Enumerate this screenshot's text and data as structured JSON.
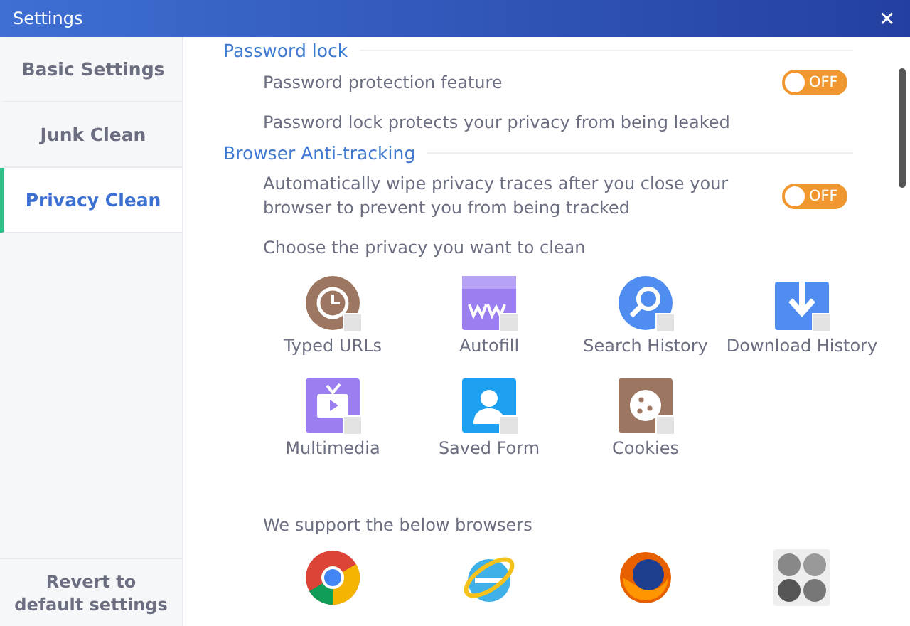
{
  "window": {
    "title": "Settings",
    "close": "✕"
  },
  "sidebar": {
    "items": [
      {
        "label": "Basic Settings",
        "selected": false
      },
      {
        "label": "Junk Clean",
        "selected": false
      },
      {
        "label": "Privacy Clean",
        "selected": true
      }
    ],
    "footer": "Revert to default settings"
  },
  "sections": [
    {
      "title": "Password lock",
      "rows": [
        {
          "text": "Password protection feature",
          "toggle": {
            "on": false,
            "label": "OFF"
          }
        },
        {
          "text": "Password lock protects your privacy from being leaked"
        }
      ]
    },
    {
      "title": "Browser Anti-tracking",
      "rows": [
        {
          "text": "Automatically wipe privacy traces after you close your browser to prevent you from being tracked",
          "toggle": {
            "on": false,
            "label": "OFF"
          }
        },
        {
          "text": "Choose the privacy you want to clean"
        }
      ]
    }
  ],
  "privacy_items": [
    {
      "label": "Typed URLs",
      "checked": false
    },
    {
      "label": "Autofill",
      "checked": false
    },
    {
      "label": "Search History",
      "checked": false
    },
    {
      "label": "Download History",
      "checked": false
    },
    {
      "label": "Multimedia",
      "checked": false
    },
    {
      "label": "Saved Form",
      "checked": false
    },
    {
      "label": "Cookies",
      "checked": false
    }
  ],
  "browsers_title": "We support the below browsers"
}
